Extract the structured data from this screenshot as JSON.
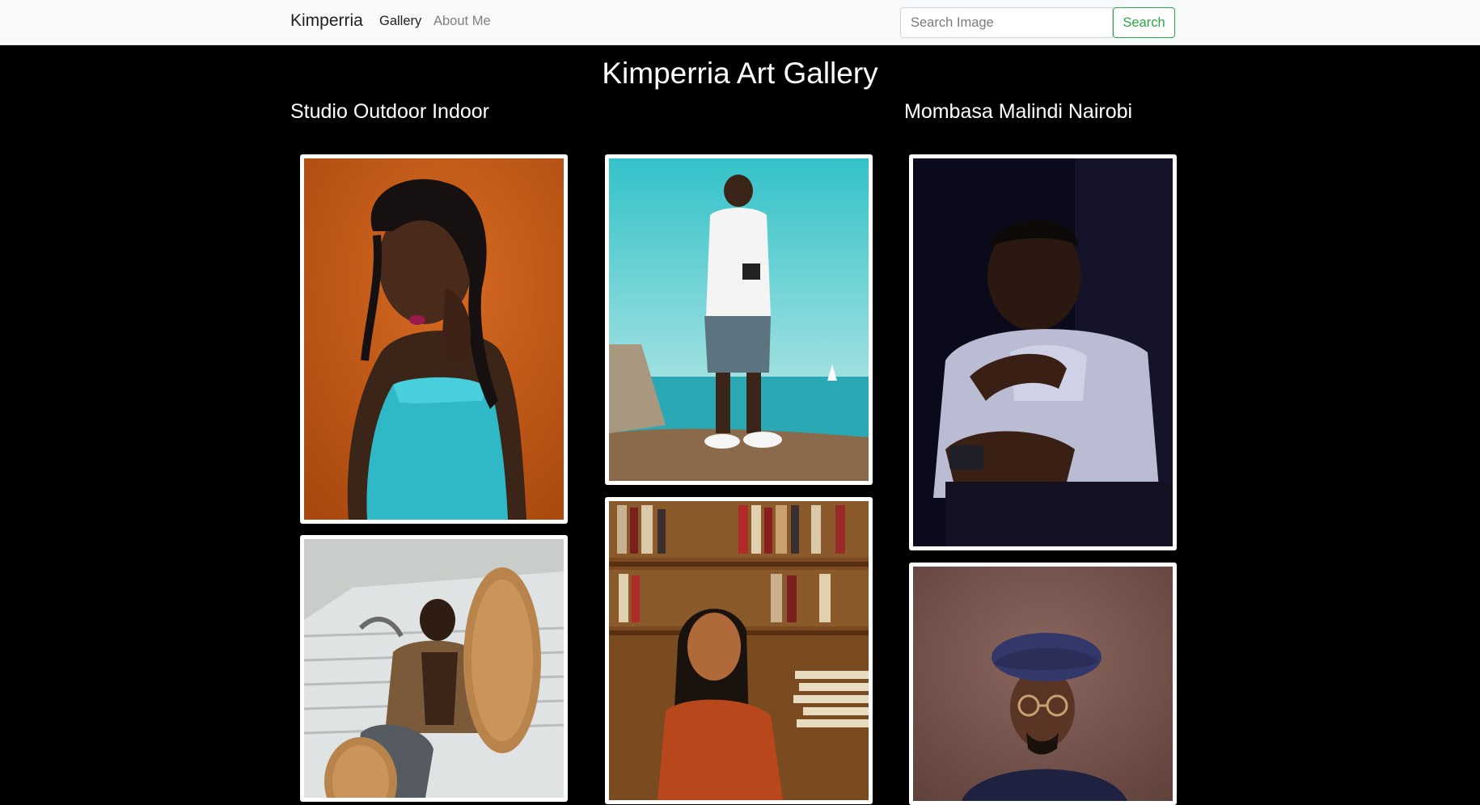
{
  "navbar": {
    "brand": "Kimperria",
    "links": [
      {
        "label": "Gallery",
        "active": true
      },
      {
        "label": "About Me",
        "active": false
      }
    ],
    "search": {
      "placeholder": "Search Image",
      "value": "",
      "button_label": "Search"
    }
  },
  "main": {
    "title": "Kimperria Art Gallery",
    "column_titles": [
      "Studio Outdoor Indoor",
      "Mombasa Malindi Nairobi"
    ]
  },
  "colors": {
    "navbar_bg": "#f8f9fa",
    "page_bg": "#000000",
    "accent_green": "#28a745"
  }
}
